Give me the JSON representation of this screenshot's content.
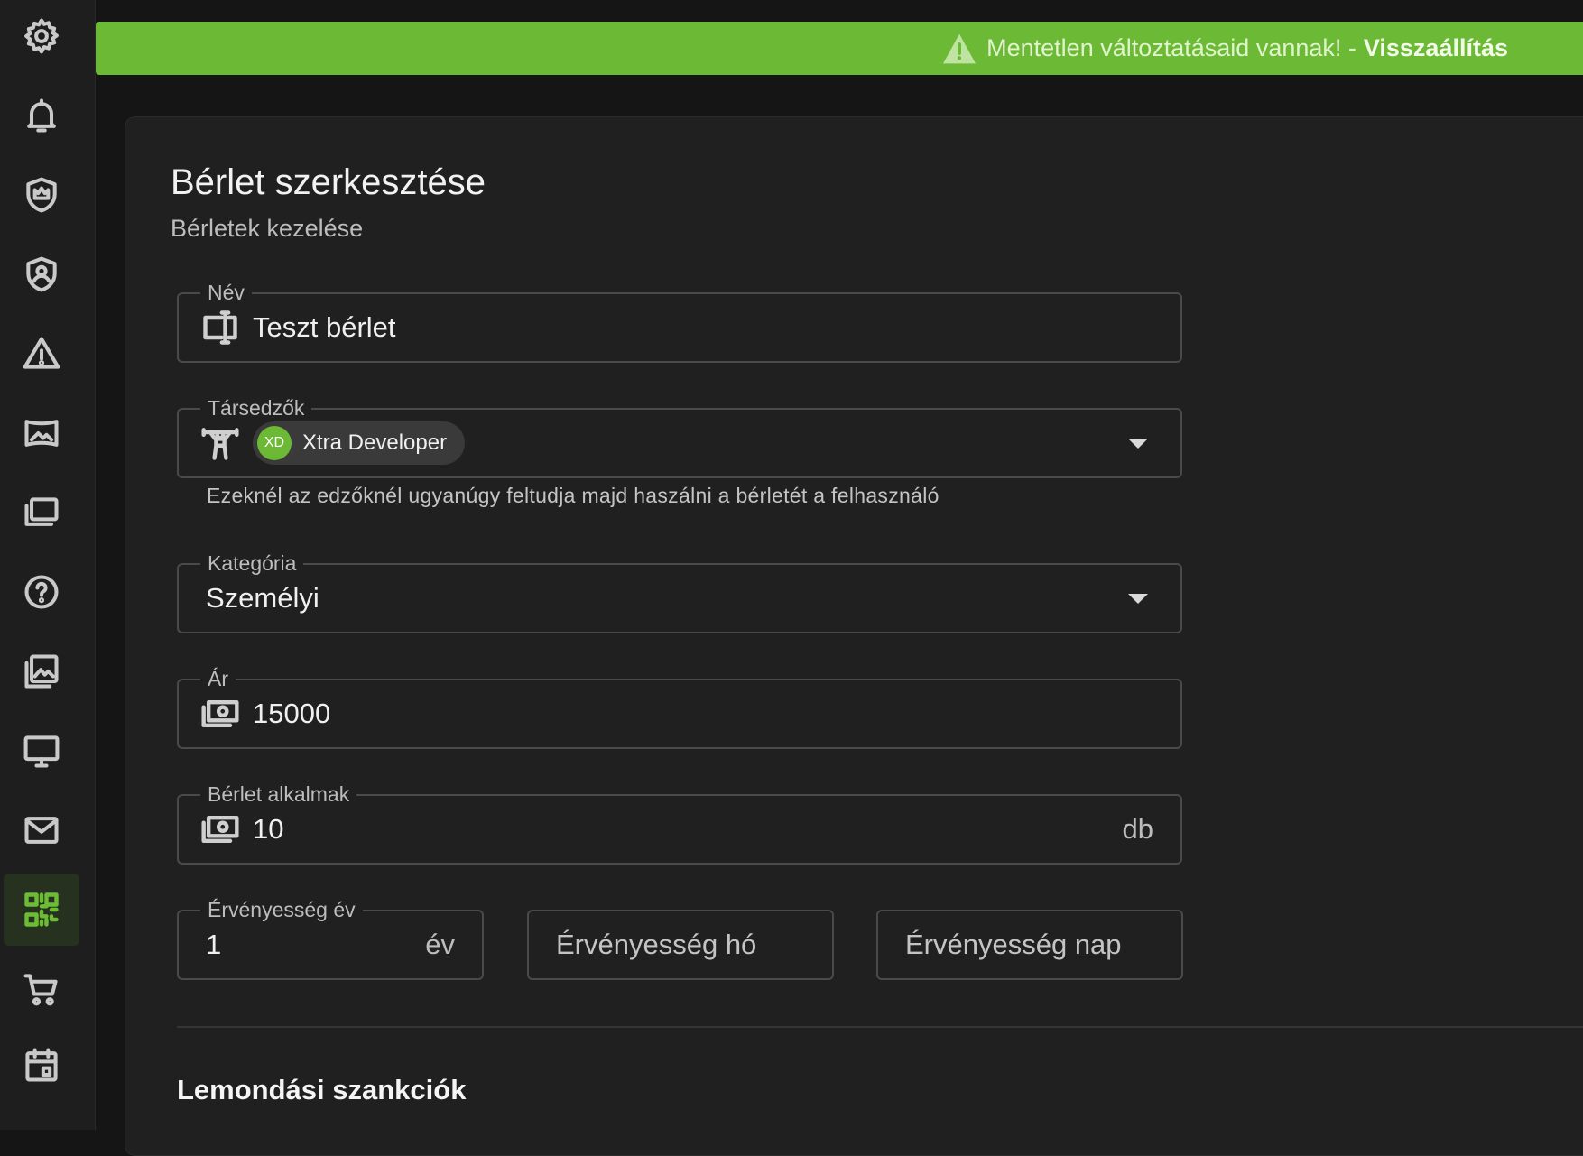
{
  "sidebar": {
    "items": [
      {
        "icon": "gear-icon"
      },
      {
        "icon": "bell-icon"
      },
      {
        "icon": "shield-crown-icon"
      },
      {
        "icon": "shield-account-icon"
      },
      {
        "icon": "alert-triangle-icon"
      },
      {
        "icon": "panorama-icon"
      },
      {
        "icon": "stack-cards-icon"
      },
      {
        "icon": "help-circle-icon"
      },
      {
        "icon": "image-stack-icon"
      },
      {
        "icon": "monitor-icon"
      },
      {
        "icon": "mail-icon"
      },
      {
        "icon": "qr-code-icon",
        "active": true
      },
      {
        "icon": "cart-icon"
      },
      {
        "icon": "calendar-icon"
      }
    ],
    "active_color": "#6cbd35"
  },
  "banner": {
    "message": "Mentetlen változtatásaid vannak! -",
    "action": "Visszaállítás",
    "color": "#6cb935"
  },
  "form": {
    "title": "Bérlet szerkesztése",
    "subtitle": "Bérletek kezelése",
    "name": {
      "label": "Név",
      "value": "Teszt bérlet",
      "icon": "form-textbox-icon"
    },
    "coaches": {
      "label": "Társedzők",
      "icon": "weightlifter-icon",
      "chips": [
        {
          "initials": "XD",
          "name": "Xtra Developer"
        }
      ],
      "helper": "Ezeknél az edzőknél ugyanúgy feltudja majd haszálni a bérletét a felhasználó"
    },
    "category": {
      "label": "Kategória",
      "value": "Személyi"
    },
    "price": {
      "label": "Ár",
      "value": "15000",
      "icon": "cash-icon"
    },
    "occasions": {
      "label": "Bérlet alkalmak",
      "value": "10",
      "suffix": "db",
      "icon": "cash-icon"
    },
    "validity_year": {
      "label": "Érvényesség év",
      "value": "1",
      "suffix": "év"
    },
    "validity_month": {
      "placeholder": "Érvényesség hó"
    },
    "validity_day": {
      "placeholder": "Érvényesség nap"
    },
    "section_title": "Lemondási szankciók"
  }
}
